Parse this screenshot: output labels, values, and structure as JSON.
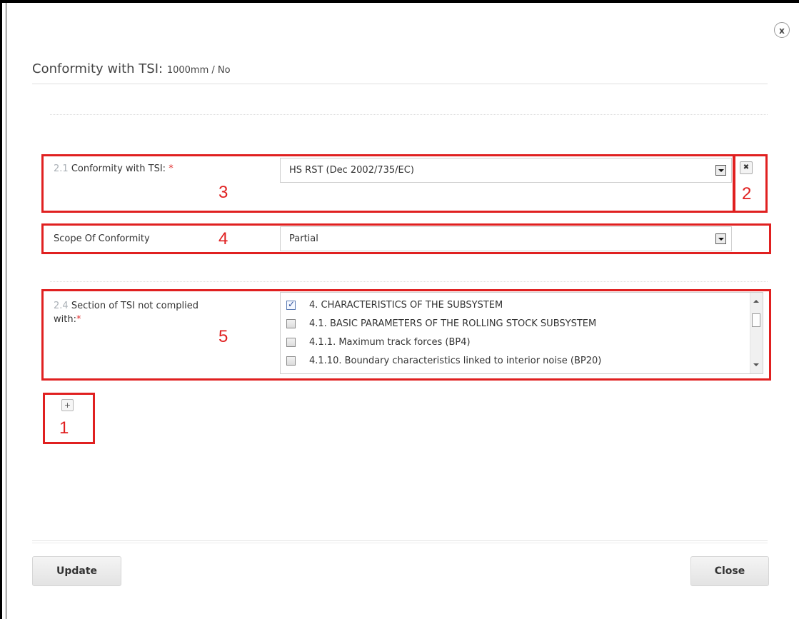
{
  "dialog": {
    "close_icon_glyph": "x",
    "title": "Conformity with TSI:",
    "subtitle": "1000mm / No"
  },
  "conformity": {
    "number": "2.1",
    "label": "Conformity with TSI:",
    "required_mark": "*",
    "selected": "HS RST (Dec 2002/735/EC)",
    "remove_glyph": "✖"
  },
  "scope": {
    "label": "Scope Of Conformity",
    "selected": "Partial"
  },
  "section": {
    "number": "2.4",
    "label_line1": "Section of TSI not complied",
    "label_line2": "with:",
    "required_mark": "*",
    "items": [
      {
        "text": "4. CHARACTERISTICS OF THE SUBSYSTEM",
        "checked": true
      },
      {
        "text": "4.1. BASIC PARAMETERS OF THE ROLLING STOCK SUBSYSTEM",
        "checked": false
      },
      {
        "text": "4.1.1. Maximum track forces (BP4)",
        "checked": false
      },
      {
        "text": "4.1.10. Boundary characteristics linked to interior noise (BP20)",
        "checked": false
      }
    ]
  },
  "add_glyph": "+",
  "annotations": {
    "a1": "1",
    "a2": "2",
    "a3": "3",
    "a4": "4",
    "a5": "5",
    "color": "#e02020"
  },
  "footer": {
    "update_label": "Update",
    "close_label": "Close"
  }
}
